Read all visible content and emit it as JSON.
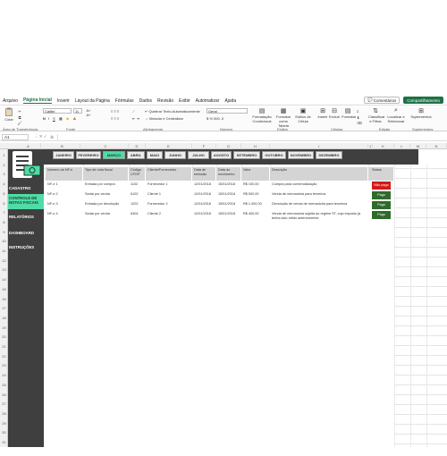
{
  "menu": {
    "tabs": [
      "Arquivo",
      "Página Inicial",
      "Inserir",
      "Layout da Página",
      "Fórmulas",
      "Dados",
      "Revisão",
      "Exibir",
      "Automatizar",
      "Ajuda"
    ],
    "comments_label": "Comentários",
    "share_label": "Compartilhamento"
  },
  "ribbon": {
    "paste_label": "Colar",
    "font_name": "Calibri",
    "font_size": "11",
    "wrap_text_label": "Quebrar Texto Automaticamente",
    "merge_label": "Mesclar e Centralizar",
    "number_format": "Geral",
    "conditional_format_label": "Formatação Condicional",
    "format_table_label": "Formatar como Tabela",
    "cell_styles_label": "Estilos de Célula",
    "insert_label": "Inserir",
    "delete_label": "Excluir",
    "format_label": "Formatar",
    "sort_filter_label": "Classificar e Filtrar",
    "find_select_label": "Localizar e Selecionar",
    "addins_label": "Suplementos",
    "groups": {
      "clipboard": "Área de Transferência",
      "font": "Fonte",
      "alignment": "Alinhamento",
      "number": "Número",
      "styles": "Estilos",
      "cells": "Células",
      "editing": "Edição",
      "addins": "Suplementos"
    }
  },
  "formula_bar": {
    "name_box": "A1",
    "fx": "fx",
    "value": ""
  },
  "columns": [
    "A",
    "B",
    "C",
    "D",
    "E",
    "F",
    "G",
    "H",
    "I",
    "J",
    "K",
    "L",
    "M",
    "N"
  ],
  "rows": [
    "1",
    "2",
    "3",
    "4",
    "5",
    "6",
    "7",
    "8",
    "9",
    "10",
    "11",
    "12",
    "13",
    "14",
    "15",
    "16",
    "17",
    "18",
    "19",
    "20",
    "21",
    "22",
    "23",
    "24",
    "25",
    "26",
    "27",
    "28",
    "29",
    "30",
    "31"
  ],
  "sidebar": {
    "items": [
      {
        "label": "CADASTRO"
      },
      {
        "label": "CONTROLE DE NOTAS FISCAIS"
      },
      {
        "label": "RELATÓRIOS"
      },
      {
        "label": "DASHBOARD"
      },
      {
        "label": "INSTRUÇÕES"
      }
    ]
  },
  "months": {
    "items": [
      "JANEIRO",
      "FEVEREIRO",
      "MARÇO",
      "ABRIL",
      "MAIO",
      "JUNHO",
      "JULHO",
      "AGOSTO",
      "SETEMBRO",
      "OUTUBRO",
      "NOVEMBRO",
      "DEZEMBRO"
    ],
    "active": "MARÇO"
  },
  "table": {
    "headers": [
      "Número da NF-e",
      "Tipo de nota fiscal",
      "Código CFOP",
      "Cliente/Fornecedor",
      "Data de emissão",
      "Data do movimento",
      "Valor",
      "Descrição",
      "Status"
    ],
    "rows": [
      [
        "NF-e 1",
        "Entrada por compra",
        "1102",
        "Fornecedor 1",
        "12/01/2018",
        "15/01/2018",
        "R$ 100,00",
        "Compra para comercialização",
        "Não pago"
      ],
      [
        "NF-e 2",
        "Saída por venda",
        "6102",
        "Cliente 1",
        "12/01/2018",
        "15/01/2018",
        "R$ 500,00",
        "Venda de mercadoria para terceiros",
        "Pago"
      ],
      [
        "NF-e 3",
        "Entrada por devolução",
        "1202",
        "Fornecedor 2",
        "12/01/2018",
        "15/01/2018",
        "R$ 1.000,00",
        "Devolução de venda de mercadoria para terceiros",
        "Pago"
      ],
      [
        "NF-e 4",
        "Saída por venda",
        "6404",
        "Cliente 2",
        "12/01/2018",
        "15/01/2018",
        "R$ 400,00",
        "Venda de mercadoria sujeita ao regime ST, cujo imposto já tenha sido retido anteriormente",
        "Pago"
      ]
    ]
  },
  "colors": {
    "sidebar_bg": "#3f3f3f",
    "accent": "#4fdca6",
    "unpaid": "#d11a1a",
    "paid": "#2e6b2a",
    "excel_green": "#1e7145"
  }
}
